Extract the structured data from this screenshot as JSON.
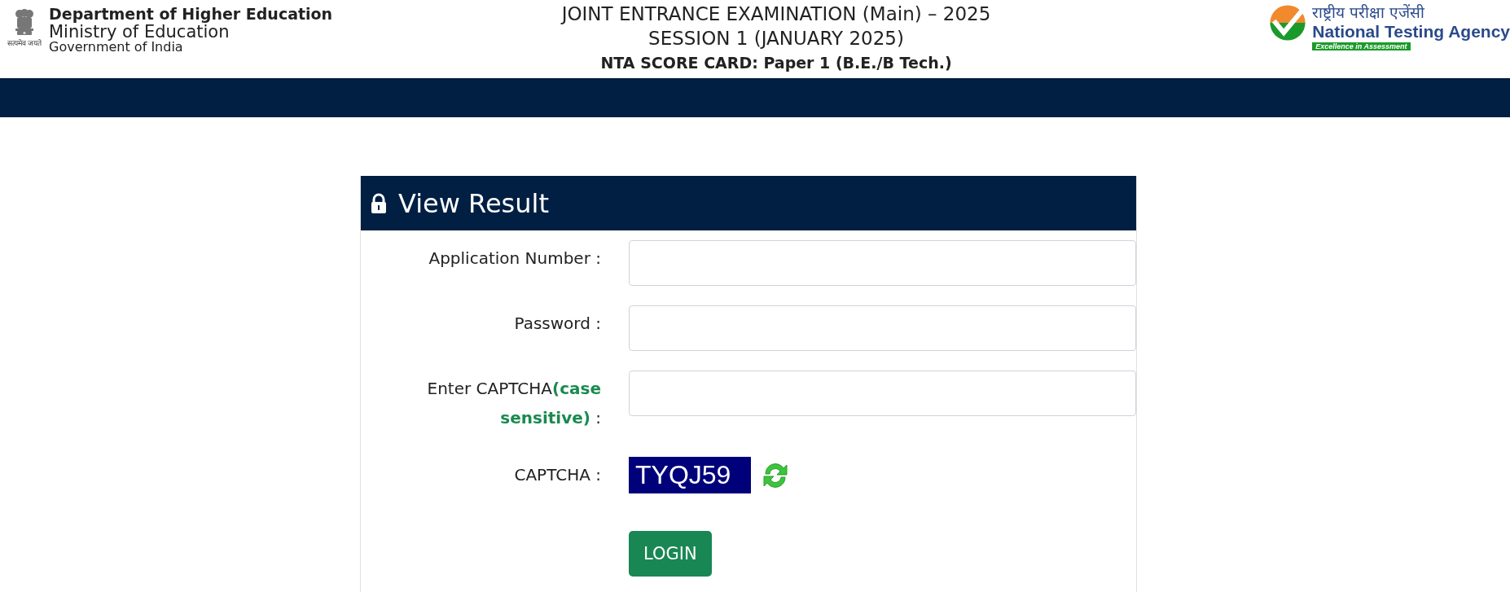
{
  "header": {
    "left_logo": {
      "motto": "सत्यमेव जयते",
      "lines": [
        "Department of Higher Education",
        "Ministry of Education",
        "Government of India"
      ]
    },
    "titles": [
      "JOINT ENTRANCE EXAMINATION (Main) – 2025",
      "SESSION 1 (JANUARY 2025)",
      "NTA SCORE CARD: Paper 1 (B.E./B Tech.)"
    ],
    "right_logo": {
      "hindi": "राष्ट्रीय परीक्षा एजेंसी",
      "name": "National Testing Agency",
      "tagline": "Excellence in Assessment"
    }
  },
  "form": {
    "title": "View Result",
    "fields": [
      {
        "kind": "input",
        "label": "Application Number :"
      },
      {
        "kind": "input",
        "label": "Password :"
      },
      {
        "kind": "input",
        "label": "Enter CAPTCHA**(case sensitive)** :"
      },
      {
        "kind": "captcha",
        "label": "CAPTCHA :",
        "captcha_text": "TYQJ59"
      }
    ],
    "button": "LOGIN"
  }
}
